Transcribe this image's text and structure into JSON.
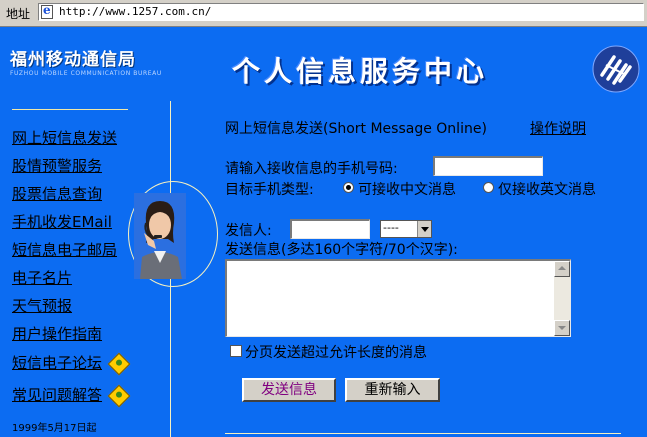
{
  "browser": {
    "address_label": "地址",
    "url": "http://www.1257.com.cn/"
  },
  "header": {
    "logo_title": "福州移动通信局",
    "logo_subtitle": "FUZHOU MOBILE COMMUNICATION BUREAU",
    "page_title": "个人信息服务中心"
  },
  "sidebar": {
    "items": [
      {
        "label": "网上短信息发送"
      },
      {
        "label": "股情预警服务"
      },
      {
        "label": "股票信息查询"
      },
      {
        "label": "手机收发EMail"
      },
      {
        "label": "短信息电子邮局"
      },
      {
        "label": "电子名片"
      },
      {
        "label": "天气预报"
      },
      {
        "label": "用户操作指南"
      },
      {
        "label": "短信电子论坛"
      },
      {
        "label": "常见问题解答"
      }
    ],
    "since_text": "1999年5月17日起"
  },
  "form": {
    "heading": "网上短信息发送(Short Message Online)",
    "help_link": "操作说明",
    "phone_label": "请输入接收信息的手机号码:",
    "phone_value": "",
    "phone_type_label": "目标手机类型:",
    "radio_chinese": "可接收中文消息",
    "radio_english": "仅接收英文消息",
    "radio_selected": "chinese",
    "sender_label": "发信人:",
    "sender_value": "",
    "sender_select_value": "----",
    "message_label": "发送信息(多达160个字符/70个汉字):",
    "message_value": "",
    "split_checkbox_label": "分页发送超过允许长度的消息",
    "split_checked": false,
    "send_button": "发送信息",
    "reset_button": "重新输入"
  },
  "colors": {
    "page_bg": "#0c6cf2",
    "send_button_text": "#800080",
    "reset_button_text": "#000000"
  }
}
